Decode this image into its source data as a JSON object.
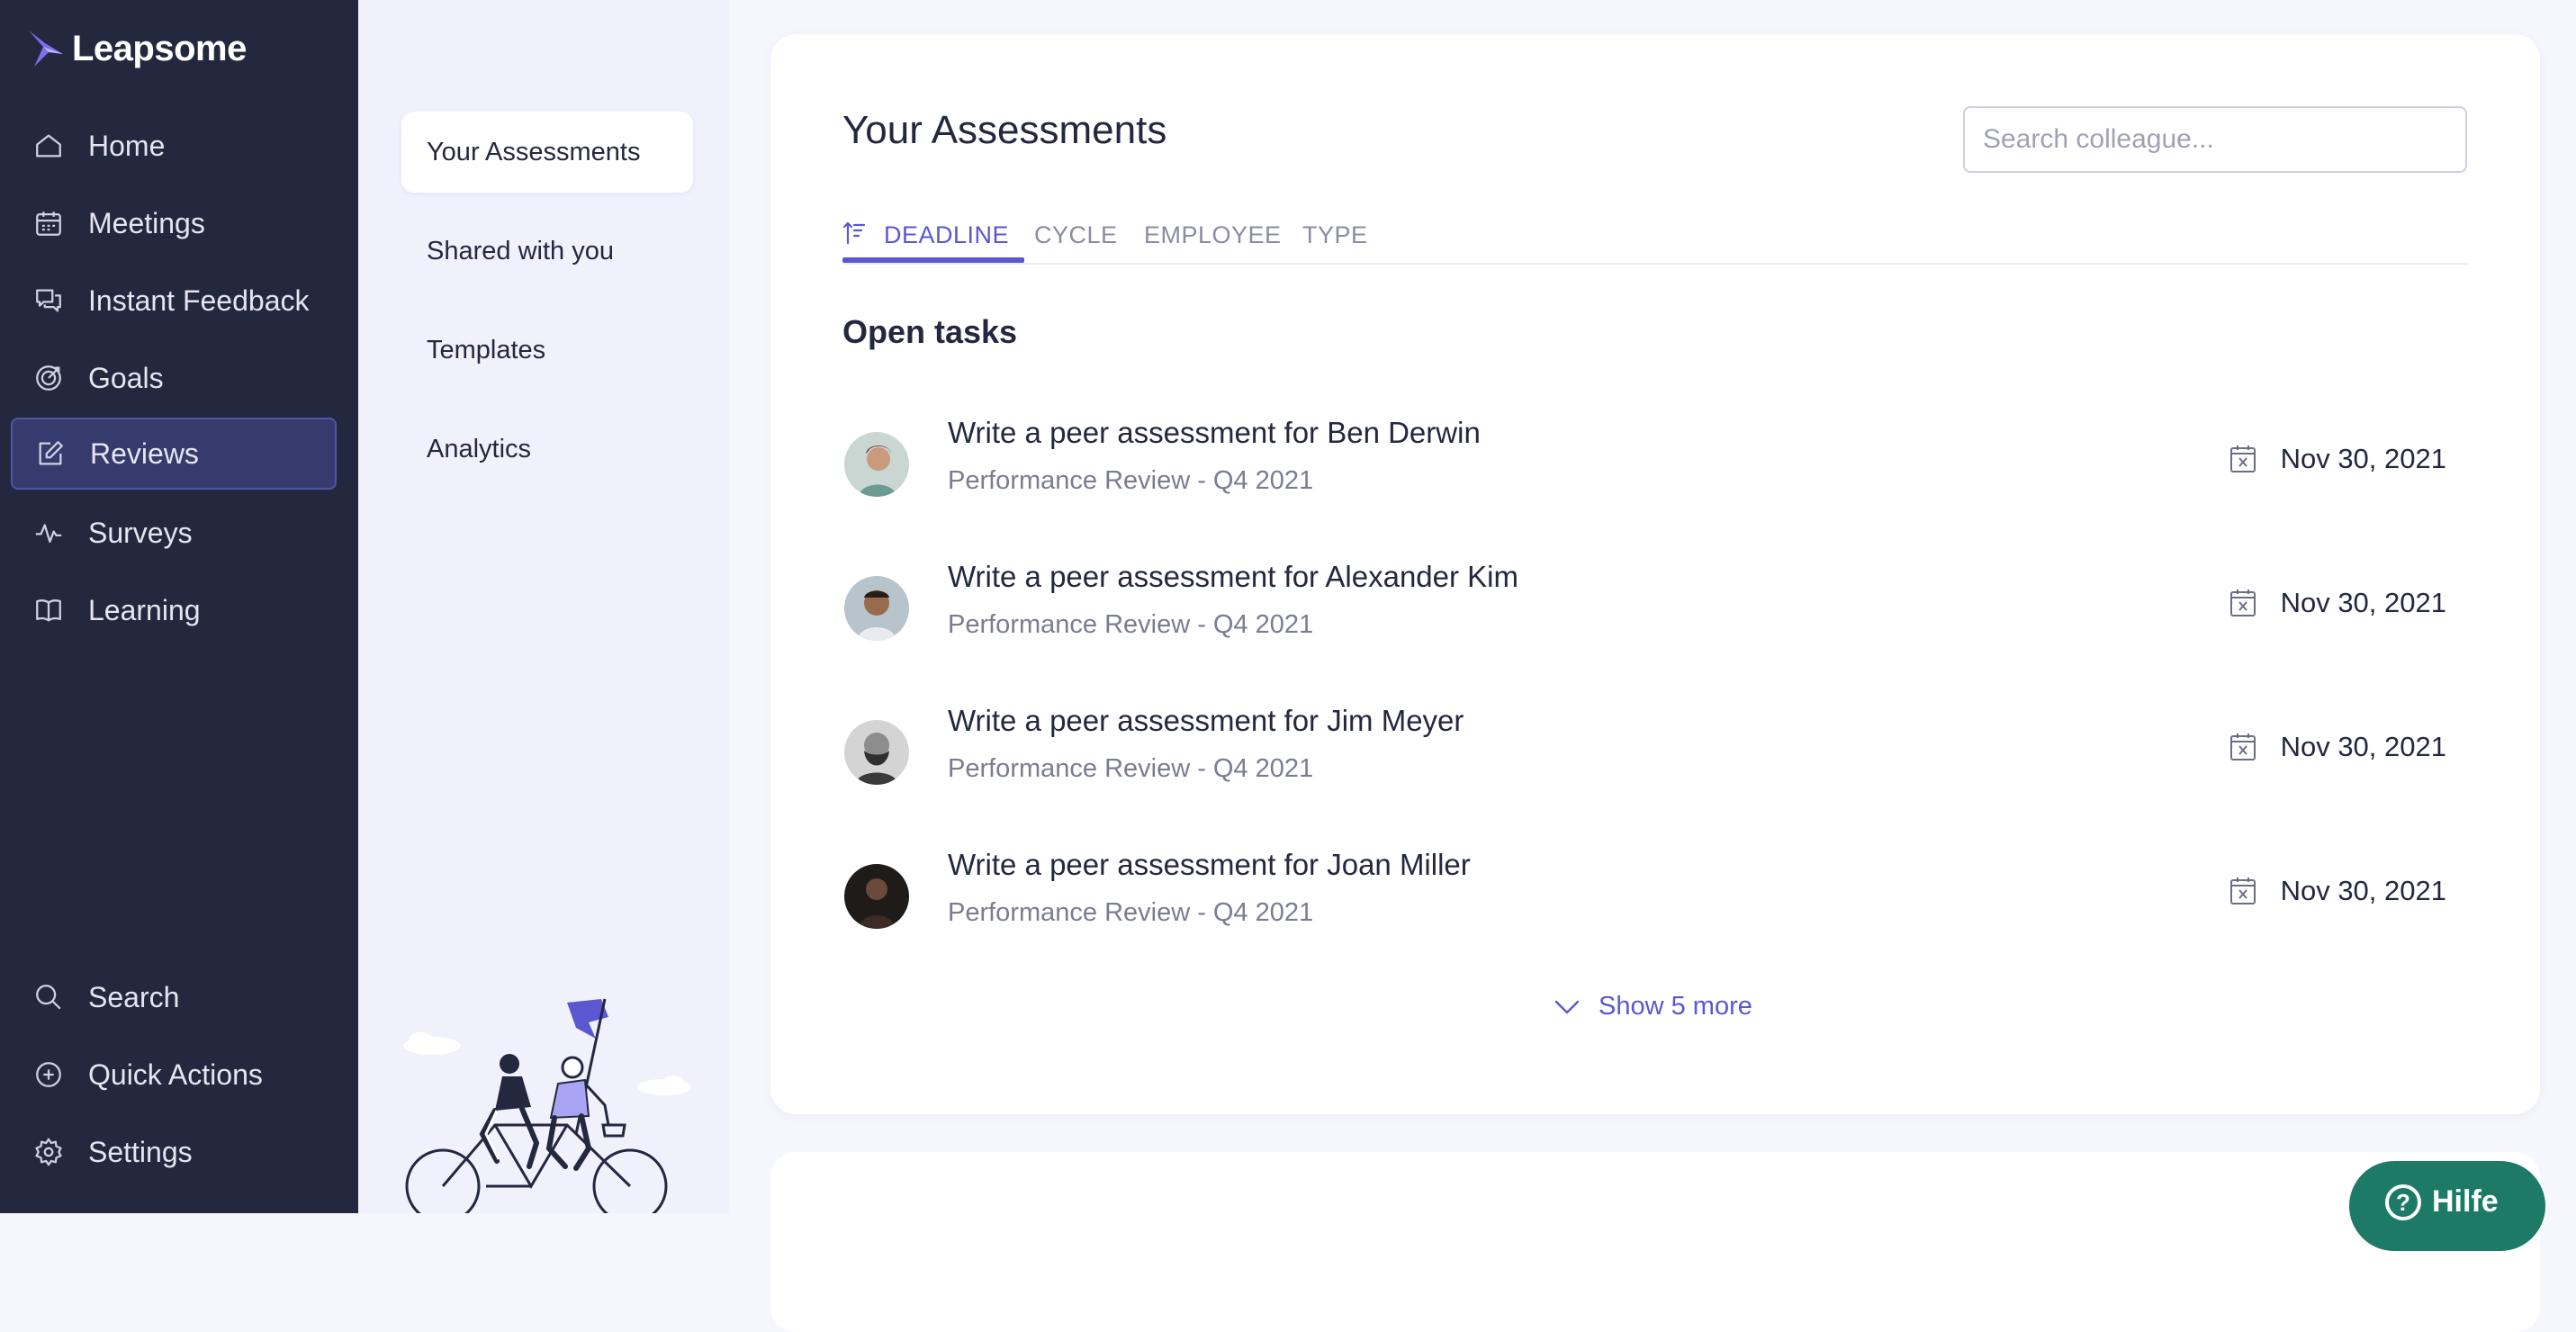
{
  "brand": {
    "name": "Leapsome",
    "accent": "#5b57d1",
    "nav_bg": "#24283f"
  },
  "nav": {
    "items": [
      {
        "label": "Home",
        "icon": "home-icon"
      },
      {
        "label": "Meetings",
        "icon": "calendar-icon"
      },
      {
        "label": "Instant Feedback",
        "icon": "chat-bubbles-icon"
      },
      {
        "label": "Goals",
        "icon": "target-icon"
      },
      {
        "label": "Reviews",
        "icon": "edit-icon",
        "active": true
      },
      {
        "label": "Surveys",
        "icon": "pulse-icon"
      },
      {
        "label": "Learning",
        "icon": "book-icon"
      }
    ],
    "bottom_items": [
      {
        "label": "Search",
        "icon": "search-icon"
      },
      {
        "label": "Quick Actions",
        "icon": "plus-circle-icon"
      },
      {
        "label": "Settings",
        "icon": "gear-icon"
      }
    ]
  },
  "subnav": {
    "items": [
      {
        "label": "Your Assessments",
        "active": true
      },
      {
        "label": "Shared with you"
      },
      {
        "label": "Templates"
      },
      {
        "label": "Analytics"
      }
    ]
  },
  "main": {
    "title": "Your Assessments",
    "search_placeholder": "Search colleague...",
    "tabs": [
      {
        "label": "DEADLINE",
        "active": true
      },
      {
        "label": "CYCLE"
      },
      {
        "label": "EMPLOYEE"
      },
      {
        "label": "TYPE"
      }
    ],
    "section_title": "Open tasks",
    "tasks": [
      {
        "title": "Write a peer assessment for Ben Derwin",
        "subtitle": "Performance Review - Q4 2021",
        "due": "Nov 30, 2021"
      },
      {
        "title": "Write a peer assessment for Alexander Kim",
        "subtitle": "Performance Review - Q4 2021",
        "due": "Nov 30, 2021"
      },
      {
        "title": "Write a peer assessment for Jim Meyer",
        "subtitle": "Performance Review - Q4 2021",
        "due": "Nov 30, 2021"
      },
      {
        "title": "Write a peer assessment for Joan Miller",
        "subtitle": "Performance Review - Q4 2021",
        "due": "Nov 30, 2021"
      }
    ],
    "show_more": "Show 5 more"
  },
  "help": {
    "label": "Hilfe",
    "color": "#1c7a66"
  }
}
